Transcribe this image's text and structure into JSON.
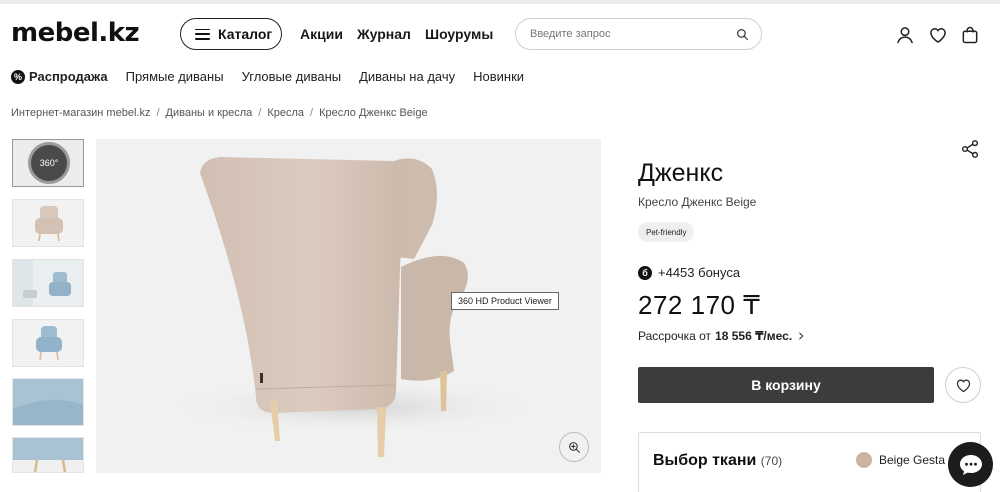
{
  "header": {
    "logo": "mebel.kz",
    "catalog_label": "Каталог",
    "nav": [
      "Акции",
      "Журнал",
      "Шоурумы"
    ],
    "search_placeholder": "Введите запрос"
  },
  "subnav": {
    "sale_badge": "%",
    "sale_label": "Распродажа",
    "items": [
      "Прямые диваны",
      "Угловые диваны",
      "Диваны на дачу",
      "Новинки"
    ]
  },
  "breadcrumb": [
    "Интернет-магазин mebel.kz",
    "Диваны и кресла",
    "Кресла",
    "Кресло Дженкс Beige"
  ],
  "gallery": {
    "badge_360": "360°",
    "viewer_label": "360 HD Product Viewer"
  },
  "product": {
    "title": "Дженкс",
    "subtitle": "Кресло Дженкс Beige",
    "tag": "Pet-friendly",
    "bonus_icon": "б",
    "bonus": "+4453 бонуса",
    "price": "272 170 ₸",
    "installment_prefix": "Рассрочка от",
    "installment_amount": "18 556 ₸/мес.",
    "cart_label": "В корзину"
  },
  "fabric": {
    "title": "Выбор ткани",
    "count": "(70)",
    "selected": "Beige Gesta",
    "swatch_color": "#cdb49f"
  },
  "colors": {
    "accent_dark": "#3c3c3c",
    "chair": "#d7c7ba"
  }
}
